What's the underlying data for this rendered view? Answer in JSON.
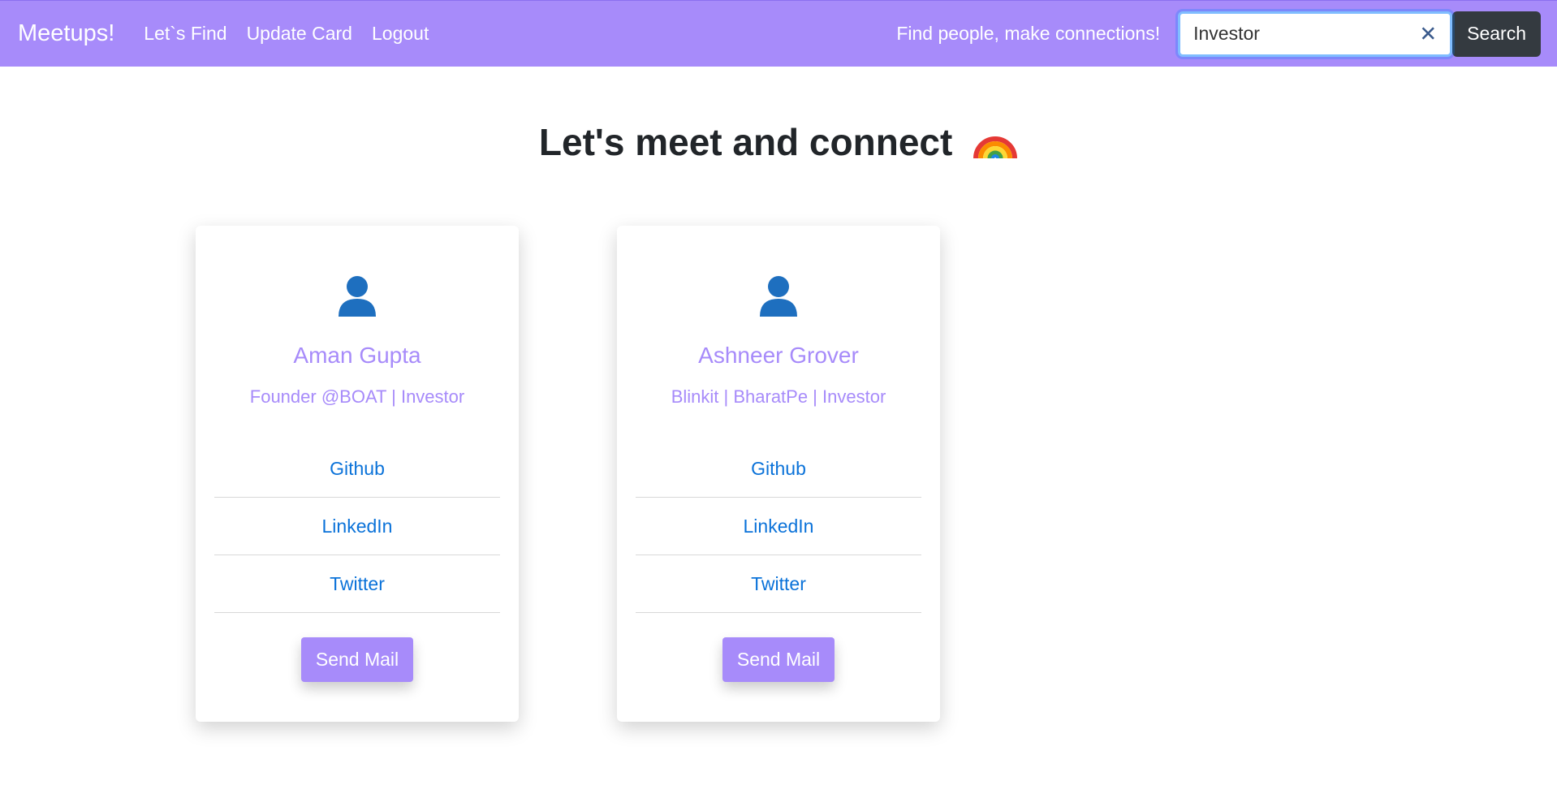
{
  "navbar": {
    "brand": "Meetups!",
    "links": [
      "Let`s Find",
      "Update Card",
      "Logout"
    ],
    "tagline": "Find people, make connections!",
    "search": {
      "value": "Investor",
      "clear_label": "✕",
      "button_label": "Search"
    }
  },
  "page": {
    "title": "Let's meet and connect"
  },
  "cards": [
    {
      "name": "Aman Gupta",
      "role": "Founder @BOAT | Investor",
      "links": [
        "Github",
        "LinkedIn",
        "Twitter"
      ],
      "mail_label": "Send Mail"
    },
    {
      "name": "Ashneer Grover",
      "role": "Blinkit | BharatPe | Investor",
      "links": [
        "Github",
        "LinkedIn",
        "Twitter"
      ],
      "mail_label": "Send Mail"
    }
  ],
  "colors": {
    "accent": "#a78bfa",
    "link": "#0a72d9",
    "dark_button": "#343a40",
    "title": "#212529"
  },
  "icons": {
    "avatar": "user-silhouette-icon",
    "title_emoji": "rainbow-icon",
    "clear": "close-icon"
  }
}
